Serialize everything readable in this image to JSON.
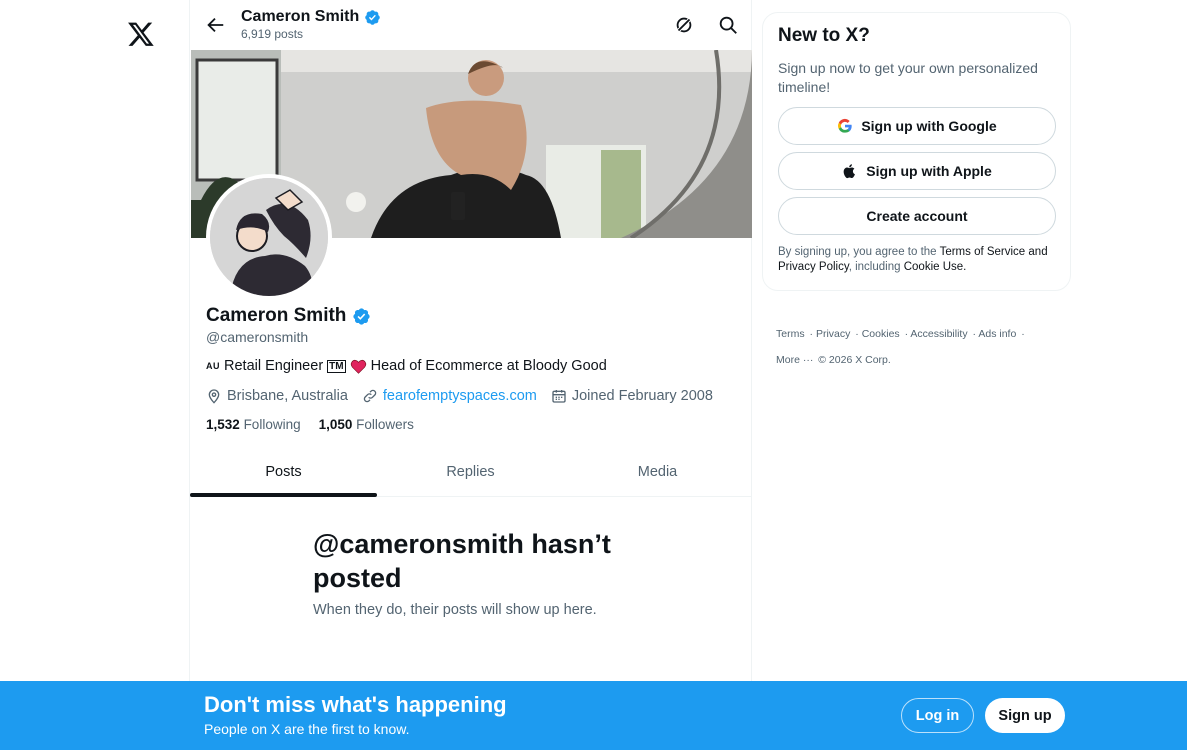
{
  "topbar": {
    "name": "Cameron Smith",
    "posts_count": "6,919 posts"
  },
  "profile": {
    "name": "Cameron Smith",
    "handle": "@cameronsmith",
    "bio_prefix": "AU",
    "bio_role": "Retail Engineer",
    "bio_tm": "TM",
    "bio_rest": "Head of Ecommerce at Bloody Good",
    "location": "Brisbane, Australia",
    "website": "fearofemptyspaces.com",
    "joined": "Joined February 2008",
    "following_count": "1,532",
    "following_label": "Following",
    "followers_count": "1,050",
    "followers_label": "Followers"
  },
  "tabs": [
    {
      "label": "Posts"
    },
    {
      "label": "Replies"
    },
    {
      "label": "Media"
    }
  ],
  "empty": {
    "title": "@cameronsmith hasn’t posted",
    "subtitle": "When they do, their posts will show up here."
  },
  "signup_card": {
    "title": "New to X?",
    "subtitle": "Sign up now to get your own personalized timeline!",
    "google_label": "Sign up with Google",
    "apple_label": "Sign up with Apple",
    "create_label": "Create account",
    "legal_1": "By signing up, you agree to the",
    "terms": "Terms of Service",
    "and": "and",
    "privacy": "Privacy Policy",
    "including": ", including",
    "cookie": "Cookie Use."
  },
  "footer": {
    "terms": "Terms",
    "privacy": "Privacy",
    "cookies": "Cookies",
    "accessibility": "Accessibility",
    "ads": "Ads info",
    "more": "More ···",
    "copyright": "© 2026 X Corp."
  },
  "bottom_bar": {
    "title": "Don't miss what's happening",
    "subtitle": "People on X are the first to know.",
    "login": "Log in",
    "signup": "Sign up"
  },
  "colors": {
    "accent": "#1d9bf0",
    "text": "#0f1419",
    "muted": "#536471",
    "heart": "#e0245e"
  },
  "icons": [
    "x-logo-icon",
    "back-arrow-icon",
    "verified-badge-icon",
    "grok-icon",
    "search-icon",
    "location-icon",
    "link-icon",
    "calendar-icon",
    "heart-icon",
    "google-icon",
    "apple-icon"
  ]
}
